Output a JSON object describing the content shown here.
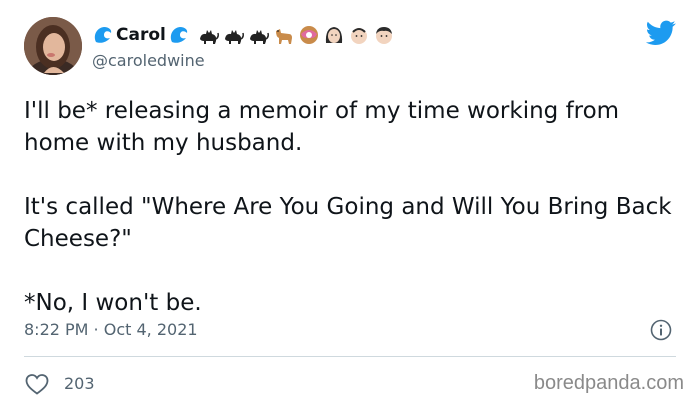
{
  "author": {
    "display_name": "Carol",
    "handle": "@caroledwine",
    "name_emojis": [
      "cat-icon",
      "cat-icon",
      "cat-icon",
      "dog-icon",
      "donut-icon",
      "woman-icon",
      "baby-icon",
      "boy-icon"
    ]
  },
  "tweet": {
    "paragraphs": [
      "I'll be* releasing a memoir of my time working from home with my husband.",
      "It's called \"Where Are You Going and Will You Bring Back Cheese?\"",
      "*No, I won't be."
    ],
    "timestamp": "8:22 PM · Oct 4, 2021",
    "like_count": "203"
  },
  "watermark": "boredpanda.com",
  "colors": {
    "twitter_blue": "#1d9bf0",
    "secondary_text": "#536471",
    "divider": "#cfd9de"
  }
}
